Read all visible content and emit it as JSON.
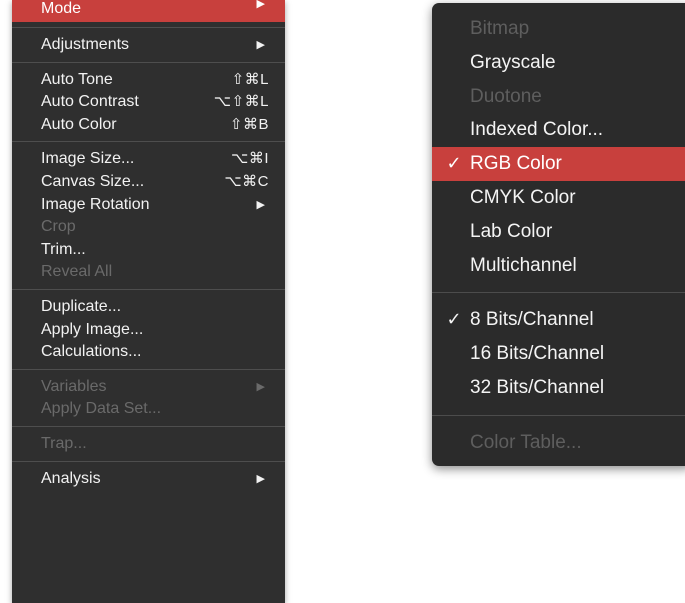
{
  "image_menu": {
    "groups": [
      [
        {
          "label": "Mode",
          "shortcut": "",
          "submenu": true,
          "enabled": true,
          "highlighted": true
        }
      ],
      [
        {
          "label": "Adjustments",
          "shortcut": "",
          "submenu": true,
          "enabled": true
        }
      ],
      [
        {
          "label": "Auto Tone",
          "shortcut": "⇧⌘L",
          "submenu": false,
          "enabled": true
        },
        {
          "label": "Auto Contrast",
          "shortcut": "⌥⇧⌘L",
          "submenu": false,
          "enabled": true
        },
        {
          "label": "Auto Color",
          "shortcut": "⇧⌘B",
          "submenu": false,
          "enabled": true
        }
      ],
      [
        {
          "label": "Image Size...",
          "shortcut": "⌥⌘I",
          "submenu": false,
          "enabled": true
        },
        {
          "label": "Canvas Size...",
          "shortcut": "⌥⌘C",
          "submenu": false,
          "enabled": true
        },
        {
          "label": "Image Rotation",
          "shortcut": "",
          "submenu": true,
          "enabled": true
        },
        {
          "label": "Crop",
          "shortcut": "",
          "submenu": false,
          "enabled": false
        },
        {
          "label": "Trim...",
          "shortcut": "",
          "submenu": false,
          "enabled": true
        },
        {
          "label": "Reveal All",
          "shortcut": "",
          "submenu": false,
          "enabled": false
        }
      ],
      [
        {
          "label": "Duplicate...",
          "shortcut": "",
          "submenu": false,
          "enabled": true
        },
        {
          "label": "Apply Image...",
          "shortcut": "",
          "submenu": false,
          "enabled": true
        },
        {
          "label": "Calculations...",
          "shortcut": "",
          "submenu": false,
          "enabled": true
        }
      ],
      [
        {
          "label": "Variables",
          "shortcut": "",
          "submenu": true,
          "enabled": false
        },
        {
          "label": "Apply Data Set...",
          "shortcut": "",
          "submenu": false,
          "enabled": false
        }
      ],
      [
        {
          "label": "Trap...",
          "shortcut": "",
          "submenu": false,
          "enabled": false
        }
      ],
      [
        {
          "label": "Analysis",
          "shortcut": "",
          "submenu": true,
          "enabled": true
        }
      ]
    ]
  },
  "mode_submenu": {
    "groups": [
      [
        {
          "label": "Bitmap",
          "checked": false,
          "enabled": false
        },
        {
          "label": "Grayscale",
          "checked": false,
          "enabled": true
        },
        {
          "label": "Duotone",
          "checked": false,
          "enabled": false
        },
        {
          "label": "Indexed Color...",
          "checked": false,
          "enabled": true
        },
        {
          "label": "RGB Color",
          "checked": true,
          "enabled": true,
          "highlighted": true
        },
        {
          "label": "CMYK Color",
          "checked": false,
          "enabled": true
        },
        {
          "label": "Lab Color",
          "checked": false,
          "enabled": true
        },
        {
          "label": "Multichannel",
          "checked": false,
          "enabled": true
        }
      ],
      [
        {
          "label": "8 Bits/Channel",
          "checked": true,
          "enabled": true
        },
        {
          "label": "16 Bits/Channel",
          "checked": false,
          "enabled": true
        },
        {
          "label": "32 Bits/Channel",
          "checked": false,
          "enabled": true
        }
      ],
      [
        {
          "label": "Color Table...",
          "checked": false,
          "enabled": false
        }
      ]
    ]
  },
  "glyphs": {
    "submenu_arrow": "▶",
    "checkmark": "✓"
  },
  "colors": {
    "highlight": "#c8403d",
    "menu_bg": "#2f2f2f",
    "disabled_text": "#6a6a6a"
  }
}
